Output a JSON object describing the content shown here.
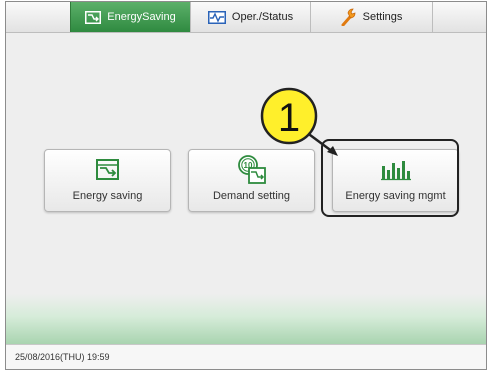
{
  "tabs": [
    {
      "label": "EnergySaving",
      "icon": "energy-saving-icon",
      "active": true
    },
    {
      "label": "Oper./Status",
      "icon": "waveform-icon",
      "active": false
    },
    {
      "label": "Settings",
      "icon": "wrench-icon",
      "active": false
    }
  ],
  "buttons": [
    {
      "label": "Energy saving",
      "icon": "energy-saving-icon"
    },
    {
      "label": "Demand setting",
      "icon": "demand-setting-icon"
    },
    {
      "label": "Energy saving mgmt",
      "icon": "bar-chart-icon"
    }
  ],
  "callout": {
    "number": "1"
  },
  "status": {
    "datetime": "25/08/2016(THU) 19:59"
  },
  "colors": {
    "accent_green": "#3a9a4a",
    "callout_yellow": "#ffef2b",
    "icon_green": "#2e8b3e"
  }
}
